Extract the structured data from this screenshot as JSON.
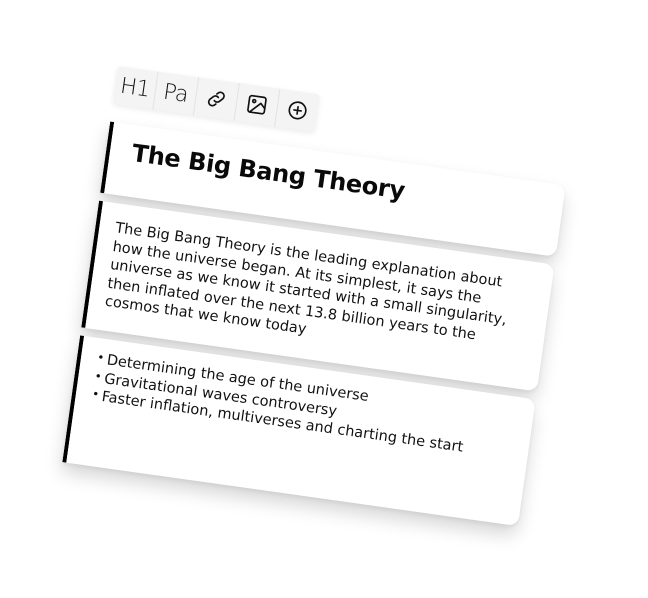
{
  "toolbar": {
    "h1_label": "H1",
    "paragraph_label": "Pa",
    "tools": [
      "link-icon",
      "image-icon",
      "add-circle-icon"
    ]
  },
  "title": "The Big Bang Theory",
  "paragraph": "The Big Bang Theory is the leading explanation about how the universe began. At its simplest, it says the universe as we know it started with a small singularity, then inflated over the next 13.8 billion years to the cosmos that we know today",
  "list": {
    "items": [
      "Determining the age of the universe",
      "Gravitational waves controversy",
      "Faster inflation, multiverses and charting the start"
    ]
  },
  "colors": {
    "accent_border": "#000000",
    "toolbar_bg": "#f4f4f4",
    "text": "#111111"
  }
}
